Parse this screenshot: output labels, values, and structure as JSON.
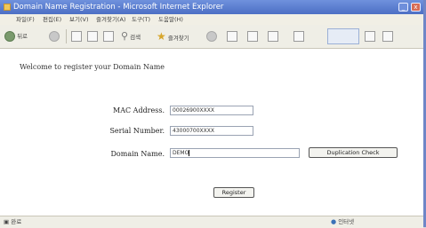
{
  "window": {
    "title": "Domain Name Registration - Microsoft Internet Explorer",
    "minimize_glyph": "_",
    "close_glyph": "x"
  },
  "menu": {
    "items": [
      "파일(F)",
      "편집(E)",
      "보기(V)",
      "즐겨찾기(A)",
      "도구(T)",
      "도움말(H)"
    ]
  },
  "toolbar": {
    "back_label": "뒤로",
    "search_label": "검색",
    "favorites_label": "즐겨찾기",
    "icons": [
      "back-icon",
      "forward-icon",
      "stop-icon",
      "refresh-icon",
      "home-icon",
      "search-icon",
      "favorites-icon",
      "history-icon",
      "mail-icon",
      "print-icon",
      "edit-icon",
      "messenger-icon"
    ]
  },
  "page": {
    "welcome": "Welcome to register your Domain Name",
    "mac_label": "MAC Address.",
    "mac_value": "00026900XXXX",
    "serial_label": "Serial Number.",
    "serial_value": "43000700XXXX",
    "domain_label": "Domain Name.",
    "domain_value": "DEMO",
    "dup_button": "Duplication Check",
    "register_button": "Register"
  },
  "status": {
    "left": "완료",
    "right": "인터넷"
  },
  "colors": {
    "titlebar": "#5b7fd3",
    "chrome": "#efeee6"
  }
}
